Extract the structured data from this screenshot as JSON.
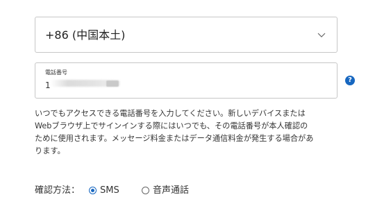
{
  "country_select": {
    "value": "+86 (中国本土)",
    "icon": "chevron-down-icon"
  },
  "phone": {
    "label": "電話番号",
    "value": "1"
  },
  "help": {
    "icon": "help-icon",
    "glyph": "?",
    "color": "#1767c0"
  },
  "description": {
    "lines": [
      "いつでもアクセスできる電話番号を入力してください。新しいデバイスまたは",
      "Webブラウザ上でサインインする際にはいつでも、その電話番号が本人確認の",
      "ために使用されます。メッセージ料金またはデータ通信料金が発生する場合があ",
      "ります。"
    ]
  },
  "verification": {
    "label": "確認方法：",
    "options": [
      {
        "label": "SMS",
        "selected": true
      },
      {
        "label": "音声通話",
        "selected": false
      }
    ]
  },
  "colors": {
    "accent": "#1767c0",
    "border": "#c6c6c6"
  }
}
